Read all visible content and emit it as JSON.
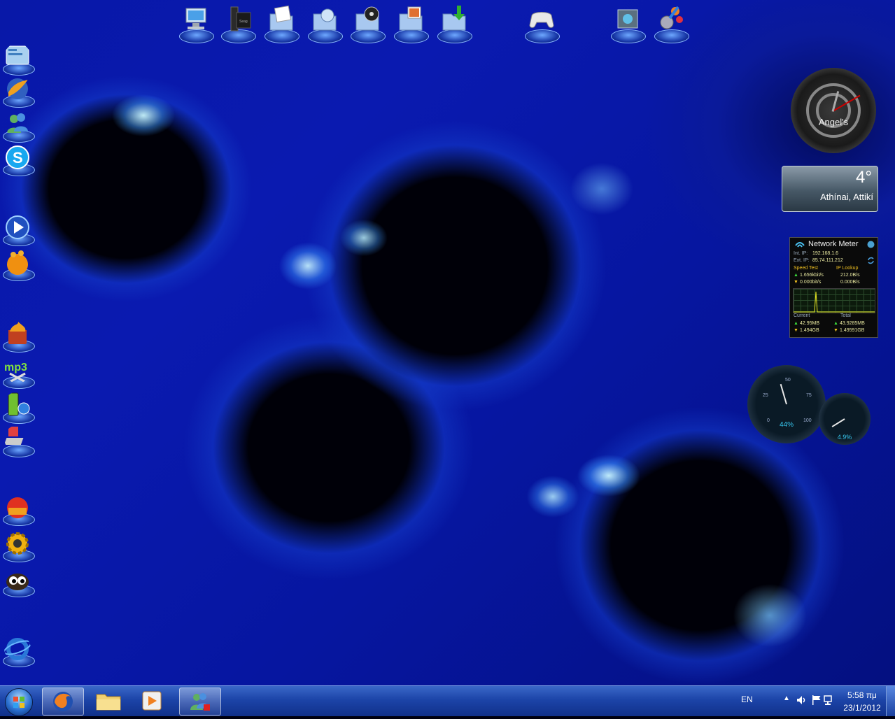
{
  "desktop": {
    "top_icons": [
      {
        "name": "computer-icon"
      },
      {
        "name": "storage-drive-icon"
      },
      {
        "name": "documents-folder-icon"
      },
      {
        "name": "web-folder-icon"
      },
      {
        "name": "music-folder-icon"
      },
      {
        "name": "pictures-folder-icon"
      },
      {
        "name": "downloads-folder-icon"
      },
      {
        "name": "gamepad-icon"
      },
      {
        "name": "control-panel-icon"
      },
      {
        "name": "settings-app-icon"
      }
    ],
    "left_icons": [
      {
        "name": "control-panel-icon"
      },
      {
        "name": "flame-app-icon"
      },
      {
        "name": "messenger-icon"
      },
      {
        "name": "skype-icon"
      },
      {
        "name": "media-player-icon"
      },
      {
        "name": "orange-app-icon"
      },
      {
        "name": "burner-icon"
      },
      {
        "name": "mp3-cutter-icon"
      },
      {
        "name": "phone-sync-icon"
      },
      {
        "name": "laptop-app-icon"
      },
      {
        "name": "cleaner-icon"
      },
      {
        "name": "gear-tool-icon"
      },
      {
        "name": "eyes-app-icon"
      },
      {
        "name": "ie-app-icon"
      }
    ]
  },
  "gadgets": {
    "clock": {
      "label": "Angel's"
    },
    "weather": {
      "temperature": "4°",
      "location": "Athínai, Attikí"
    },
    "network_meter": {
      "title": "Network Meter",
      "int_ip_label": "Int. IP:",
      "int_ip": "192.168.1.6",
      "ext_ip_label": "Ext. IP:",
      "ext_ip": "85.74.111.212",
      "speed_test_label": "Speed Test",
      "ip_lookup_label": "IP Lookup",
      "up_speed": "1.656kbit/s",
      "up_rate": "212.0B/s",
      "down_speed": "0.000bit/s",
      "down_rate": "0.000B/s",
      "current_label": "Current",
      "total_label": "Total",
      "current_up": "42.95MB",
      "total_up": "43.9285MB",
      "current_down": "1.494GB",
      "total_down": "1.49591GB"
    },
    "cpu_meter": {
      "cpu_percent": "44%",
      "ram_percent": "4.9%",
      "ticks": [
        "0",
        "25",
        "50",
        "75",
        "100"
      ],
      "cpu_fraction": 0.44,
      "ram_fraction": 0.049
    }
  },
  "taskbar": {
    "pinned": [
      {
        "name": "firefox-icon",
        "active": true
      },
      {
        "name": "explorer-folder-icon",
        "active": false
      },
      {
        "name": "media-player-taskbar-icon",
        "active": false
      },
      {
        "name": "messenger-taskbar-icon",
        "active": true
      }
    ],
    "tray": {
      "language": "EN",
      "time": "5:58 πμ",
      "date": "23/1/2012"
    }
  },
  "colors": {
    "taskbar": "#1c44a8",
    "wallpaper": "#0818a8",
    "accent": "#38c8f0"
  }
}
